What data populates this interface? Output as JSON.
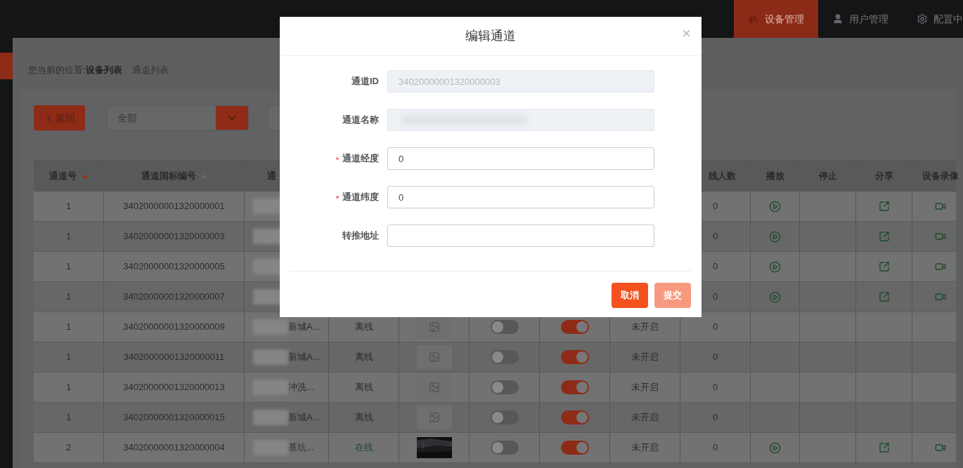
{
  "nav": {
    "items": [
      {
        "label": "设备管理",
        "selected": true
      },
      {
        "label": "用户管理",
        "selected": false
      },
      {
        "label": "配置中",
        "selected": false
      }
    ]
  },
  "sidebar": {
    "items": [
      {
        "selected": true
      }
    ]
  },
  "breadcrumb": {
    "prefix": "您当前的位置:",
    "items": [
      {
        "label": "设备列表",
        "current": false
      },
      {
        "label": "通道列表",
        "current": true
      }
    ]
  },
  "toolbar": {
    "back_label": "返回",
    "filter_value": "全部"
  },
  "table": {
    "columns": [
      {
        "label": "通道号",
        "sorted": true
      },
      {
        "label": "通道国标编号",
        "sorted": false
      },
      {
        "label": "通"
      },
      {
        "label": "线人数"
      },
      {
        "label": "播放"
      },
      {
        "label": "停止"
      },
      {
        "label": "分享"
      },
      {
        "label": "设备录像"
      }
    ],
    "rows": [
      {
        "channel_no": "1",
        "gb_code": "34020000001320000001",
        "online_count": "0",
        "actions": true
      },
      {
        "channel_no": "1",
        "gb_code": "34020000001320000003",
        "online_count": "0",
        "actions": true
      },
      {
        "channel_no": "1",
        "gb_code": "34020000001320000005",
        "online_count": "0",
        "actions": true
      },
      {
        "channel_no": "1",
        "gb_code": "34020000001320000007",
        "online_count": "0",
        "actions": true
      },
      {
        "channel_no": "1",
        "gb_code": "34020000001320000009",
        "name": "新城A...",
        "status": "离线",
        "online": false,
        "snapshot_available": false,
        "toggle_1": false,
        "toggle_2": true,
        "stream": "未开启",
        "online_count": "0",
        "actions": false
      },
      {
        "channel_no": "1",
        "gb_code": "34020000001320000011",
        "name": "新城A...",
        "status": "离线",
        "online": false,
        "snapshot_available": false,
        "toggle_1": false,
        "toggle_2": true,
        "stream": "未开启",
        "online_count": "0",
        "actions": false
      },
      {
        "channel_no": "1",
        "gb_code": "34020000001320000013",
        "name": "冲洗...",
        "status": "离线",
        "online": false,
        "snapshot_available": false,
        "toggle_1": false,
        "toggle_2": true,
        "stream": "未开启",
        "online_count": "0",
        "actions": false
      },
      {
        "channel_no": "1",
        "gb_code": "34020000001320000015",
        "name": "新城A...",
        "status": "离线",
        "online": false,
        "snapshot_available": false,
        "toggle_1": false,
        "toggle_2": true,
        "stream": "未开启",
        "online_count": "0",
        "actions": false
      },
      {
        "channel_no": "2",
        "gb_code": "34020000001320000004",
        "name": "基坑...",
        "status": "在线",
        "online": true,
        "snapshot_available": true,
        "toggle_1": false,
        "toggle_2": true,
        "stream": "未开启",
        "online_count": "0",
        "actions": true
      }
    ]
  },
  "dialog": {
    "title": "编辑通道",
    "fields": [
      {
        "label": "通道ID",
        "kind": "text",
        "value": "34020000001320000003",
        "required": false,
        "disabled": true
      },
      {
        "label": "通道名称",
        "kind": "redacted",
        "required": false,
        "disabled": true
      },
      {
        "label": "通道经度",
        "kind": "text",
        "value": "0",
        "required": true,
        "disabled": false
      },
      {
        "label": "通道纬度",
        "kind": "text",
        "value": "0",
        "required": true,
        "disabled": false
      },
      {
        "label": "转推地址",
        "kind": "text",
        "required": false,
        "disabled": false
      }
    ],
    "buttons": [
      {
        "label": "取消",
        "disabled": false
      },
      {
        "label": "提交",
        "disabled": true
      }
    ]
  }
}
